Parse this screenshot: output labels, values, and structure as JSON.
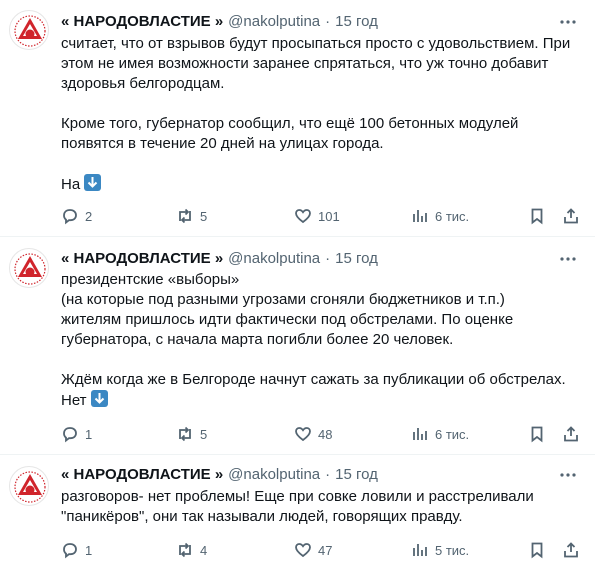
{
  "tweets": [
    {
      "author_name": "« НАРОДОВЛАСТИЕ »",
      "handle": "@nakolputina",
      "dot": "·",
      "time": "15 год",
      "lines": [
        "считает, что от взрывов будут просыпаться просто с удовольствием. При",
        "этом не имея возможности заранее спрятаться, что уж точно добавит",
        "здоровья белгородцам.",
        "",
        "Кроме того, губернатор сообщил, что ещё 100 бетонных модулей",
        "появятся в течение 20 дней на улицах города.",
        "",
        "На"
      ],
      "emoji": "arrow-down-emoji",
      "replies": "2",
      "reposts": "5",
      "likes": "101",
      "views": "6 тис."
    },
    {
      "author_name": "« НАРОДОВЛАСТИЕ »",
      "handle": "@nakolputina",
      "dot": "·",
      "time": "15 год",
      "lines": [
        "президентские «выборы»",
        "(на которые под разными угрозами сгоняли бюджетников и т.п.)",
        "жителям пришлось идти фактически под обстрелами. По оценке",
        "губернатора, с начала марта погибли более 20 человек.",
        "",
        "Ждём когда же в Белгороде начнут сажать за публикации об обстрелах.",
        "Нет"
      ],
      "emoji": "arrow-down-emoji",
      "replies": "1",
      "reposts": "5",
      "likes": "48",
      "views": "6 тис."
    },
    {
      "author_name": "« НАРОДОВЛАСТИЕ »",
      "handle": "@nakolputina",
      "dot": "·",
      "time": "15 год",
      "lines": [
        "разговоров- нет проблемы! Еще при совке ловили и расстреливали",
        "\"паникёров\", они так называли людей, говорящих правду."
      ],
      "replies": "1",
      "reposts": "4",
      "likes": "47",
      "views": "5 тис."
    }
  ],
  "colors": {
    "text": "#0f1419",
    "secondary": "#536471",
    "logo_red": "#d0242b",
    "emoji_blue": "#3b88c3"
  }
}
